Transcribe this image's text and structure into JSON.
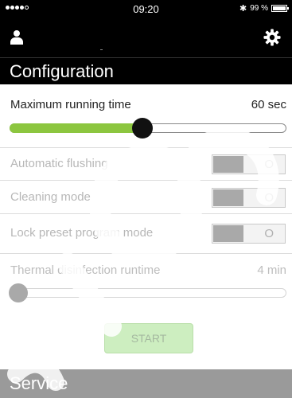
{
  "status_bar": {
    "time": "09:20",
    "battery": "99 %",
    "battery_level": 0.99,
    "bluetooth_icon": "bluetooth-icon"
  },
  "navbar": {
    "left_icon": "user-icon",
    "right_icon": "gear-icon"
  },
  "configuration": {
    "title": "Configuration",
    "max_running_time": {
      "label": "Maximum running time",
      "value": "60 sec",
      "slider_level": 0.48,
      "fill_color": "#8cc63f"
    },
    "toggles": [
      {
        "label": "Automatic flushing",
        "state": "O"
      },
      {
        "label": "Cleaning mode",
        "state": "O"
      },
      {
        "label": "Lock preset program mode",
        "state": "O"
      }
    ],
    "thermal": {
      "label": "Thermal disinfection runtime",
      "value": "4 min",
      "slider_level": 0.0
    },
    "start_label": "START"
  },
  "service": {
    "title": "Service"
  }
}
